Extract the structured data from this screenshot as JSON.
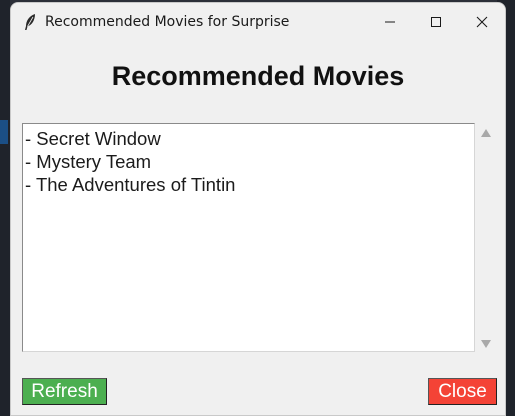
{
  "window": {
    "title": "Recommended Movies for Surprise",
    "icon": "feather-icon",
    "controls": [
      "minimize-icon",
      "maximize-icon",
      "close-icon"
    ]
  },
  "main": {
    "heading": "Recommended Movies",
    "movies": [
      "- Secret Window",
      "- Mystery Team",
      "- The Adventures of Tintin"
    ]
  },
  "buttons": {
    "refresh_label": "Refresh",
    "close_label": "Close"
  },
  "colors": {
    "refresh_bg": "#4caf50",
    "close_bg": "#f44336",
    "window_bg": "#f0f0f0",
    "list_bg": "#ffffff"
  }
}
